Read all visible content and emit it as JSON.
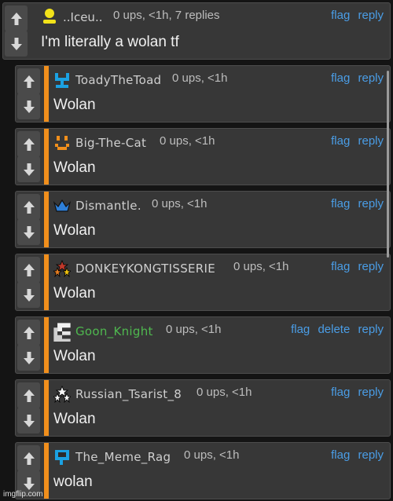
{
  "top_comment": {
    "username": "..Iceu..",
    "meta": "0 ups, <1h, 7 replies",
    "actions": [
      "flag",
      "reply"
    ],
    "body": "I'm literally a wolan tf",
    "avatar_icon": "yellow-person-icon"
  },
  "replies": [
    {
      "username": "ToadyTheToad",
      "meta": "0 ups, <1h",
      "actions": [
        "flag",
        "reply"
      ],
      "body": "Wolan",
      "avatar_icon": "blue-pixel-icon"
    },
    {
      "username": "Big-The-Cat",
      "meta": "0 ups, <1h",
      "actions": [
        "flag",
        "reply"
      ],
      "body": "Wolan",
      "avatar_icon": "orange-face-icon"
    },
    {
      "username": "Dismantle.",
      "meta": "0 ups, <1h",
      "actions": [
        "flag",
        "reply"
      ],
      "body": "Wolan",
      "avatar_icon": "blue-crown-icon"
    },
    {
      "username": "DONKEYKONGTISSERIE",
      "meta": "0 ups, <1h",
      "actions": [
        "flag",
        "reply"
      ],
      "body": "Wolan",
      "avatar_icon": "mod-stars-icon"
    },
    {
      "username": "Goon_Knight",
      "meta": "0 ups, <1h",
      "actions": [
        "flag",
        "delete",
        "reply"
      ],
      "body": "Wolan",
      "avatar_icon": "gray-pixel-icon",
      "username_color": "#4fb84f"
    },
    {
      "username": "Russian_Tsarist_8",
      "meta": "0 ups, <1h",
      "actions": [
        "flag",
        "reply"
      ],
      "body": "Wolan",
      "avatar_icon": "white-stars-icon"
    },
    {
      "username": "The_Meme_Rag",
      "meta": "0 ups, <1h",
      "actions": [
        "flag",
        "reply"
      ],
      "body": "wolan",
      "avatar_icon": "blue-flag-icon"
    }
  ],
  "watermark": "imgflip.com",
  "colors": {
    "accent": "#f18f1c",
    "link": "#4a9de6",
    "panel": "#373737"
  }
}
